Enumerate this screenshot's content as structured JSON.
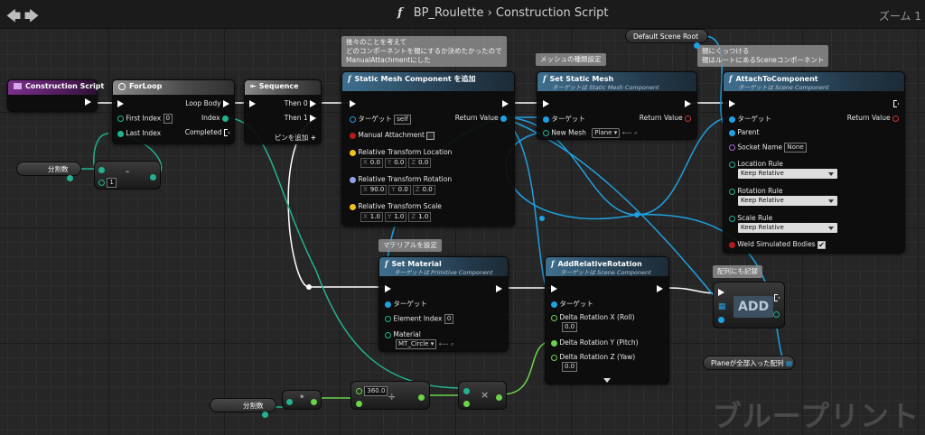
{
  "toolbar": {
    "back": "🡄",
    "forward": "🡆",
    "f": "f",
    "blueprint": "BP_Roulette",
    "sep": "›",
    "graph": "Construction Script",
    "zoom": "ズーム 1"
  },
  "watermark": "ブループリント",
  "comments": {
    "add_static_mesh": "後々のことを考えて\nどのコンポーネントを親にするか決めたかったので\nManualAttachmentにした",
    "mesh_type": "メッシュの種類設定",
    "attach": "親にくっつける\n親はルートにあるSceneコンポーネント",
    "material": "マテリアルを設定",
    "array": "配列にも記録"
  },
  "nodes": {
    "construction": {
      "title": "Construction Script"
    },
    "forloop": {
      "title": "ForLoop",
      "loop_body": "Loop Body",
      "first_index": "First Index",
      "first_index_val": "0",
      "index": "Index",
      "last_index": "Last Index",
      "completed": "Completed"
    },
    "sequence": {
      "title": "Sequence",
      "then0": "Then 0",
      "then1": "Then 1",
      "add_pin": "ピンを追加",
      "plus": "+"
    },
    "add_smc": {
      "title": "Static Mesh Component を追加",
      "target": "ターゲット",
      "target_val": "self",
      "return": "Return Value",
      "manual": "Manual Attachment",
      "loc": "Relative Transform Location",
      "loc_v": [
        "0.0",
        "0.0",
        "0.0"
      ],
      "rot": "Relative Transform Rotation",
      "rot_v": [
        "90.0",
        "0.0",
        "0.0"
      ],
      "scale": "Relative Transform Scale",
      "scale_v": [
        "1.0",
        "1.0",
        "1.0"
      ]
    },
    "set_mesh": {
      "title": "Set Static Mesh",
      "sub": "ターゲットは Static Mesh Component",
      "target": "ターゲット",
      "return": "Return Value",
      "new_mesh": "New Mesh",
      "mesh_val": "Plane"
    },
    "attach": {
      "title": "AttachToComponent",
      "sub": "ターゲットは Scene Component",
      "target": "ターゲット",
      "return": "Return Value",
      "parent": "Parent",
      "socket": "Socket Name",
      "socket_val": "None",
      "loc_rule": "Location Rule",
      "rot_rule": "Rotation Rule",
      "scale_rule": "Scale Rule",
      "rule_val": "Keep Relative",
      "weld": "Weld Simulated Bodies"
    },
    "set_material": {
      "title": "Set Material",
      "sub": "ターゲットは Primitive Component",
      "target": "ターゲット",
      "elem": "Element Index",
      "elem_val": "0",
      "material": "Material",
      "material_val": "MT_Circle"
    },
    "add_rot": {
      "title": "AddRelativeRotation",
      "sub": "ターゲットは Scene Component",
      "target": "ターゲット",
      "dx": "Delta Rotation X (Roll)",
      "dx_v": "0.0",
      "dy": "Delta Rotation Y (Pitch)",
      "dz": "Delta Rotation Z (Yaw)",
      "dz_v": "0.0"
    },
    "add_array": {
      "label": "ADD"
    }
  },
  "vars": {
    "bunkatsu1": "分割数",
    "bunkatsu2": "分割数",
    "default_root": "Default Scene Root",
    "plane_array": "Planeが全部入った配列"
  },
  "math": {
    "minus_val": "1",
    "minus": "-",
    "div_val": "360.0",
    "div": "÷",
    "mul": "×",
    "dot": "•"
  },
  "colors": {
    "exec": "#ffffff",
    "object": "#1fa0e0",
    "int": "#22b290",
    "float": "#6ad34a",
    "bool": "#b21c1c",
    "name": "#a46cd6"
  }
}
